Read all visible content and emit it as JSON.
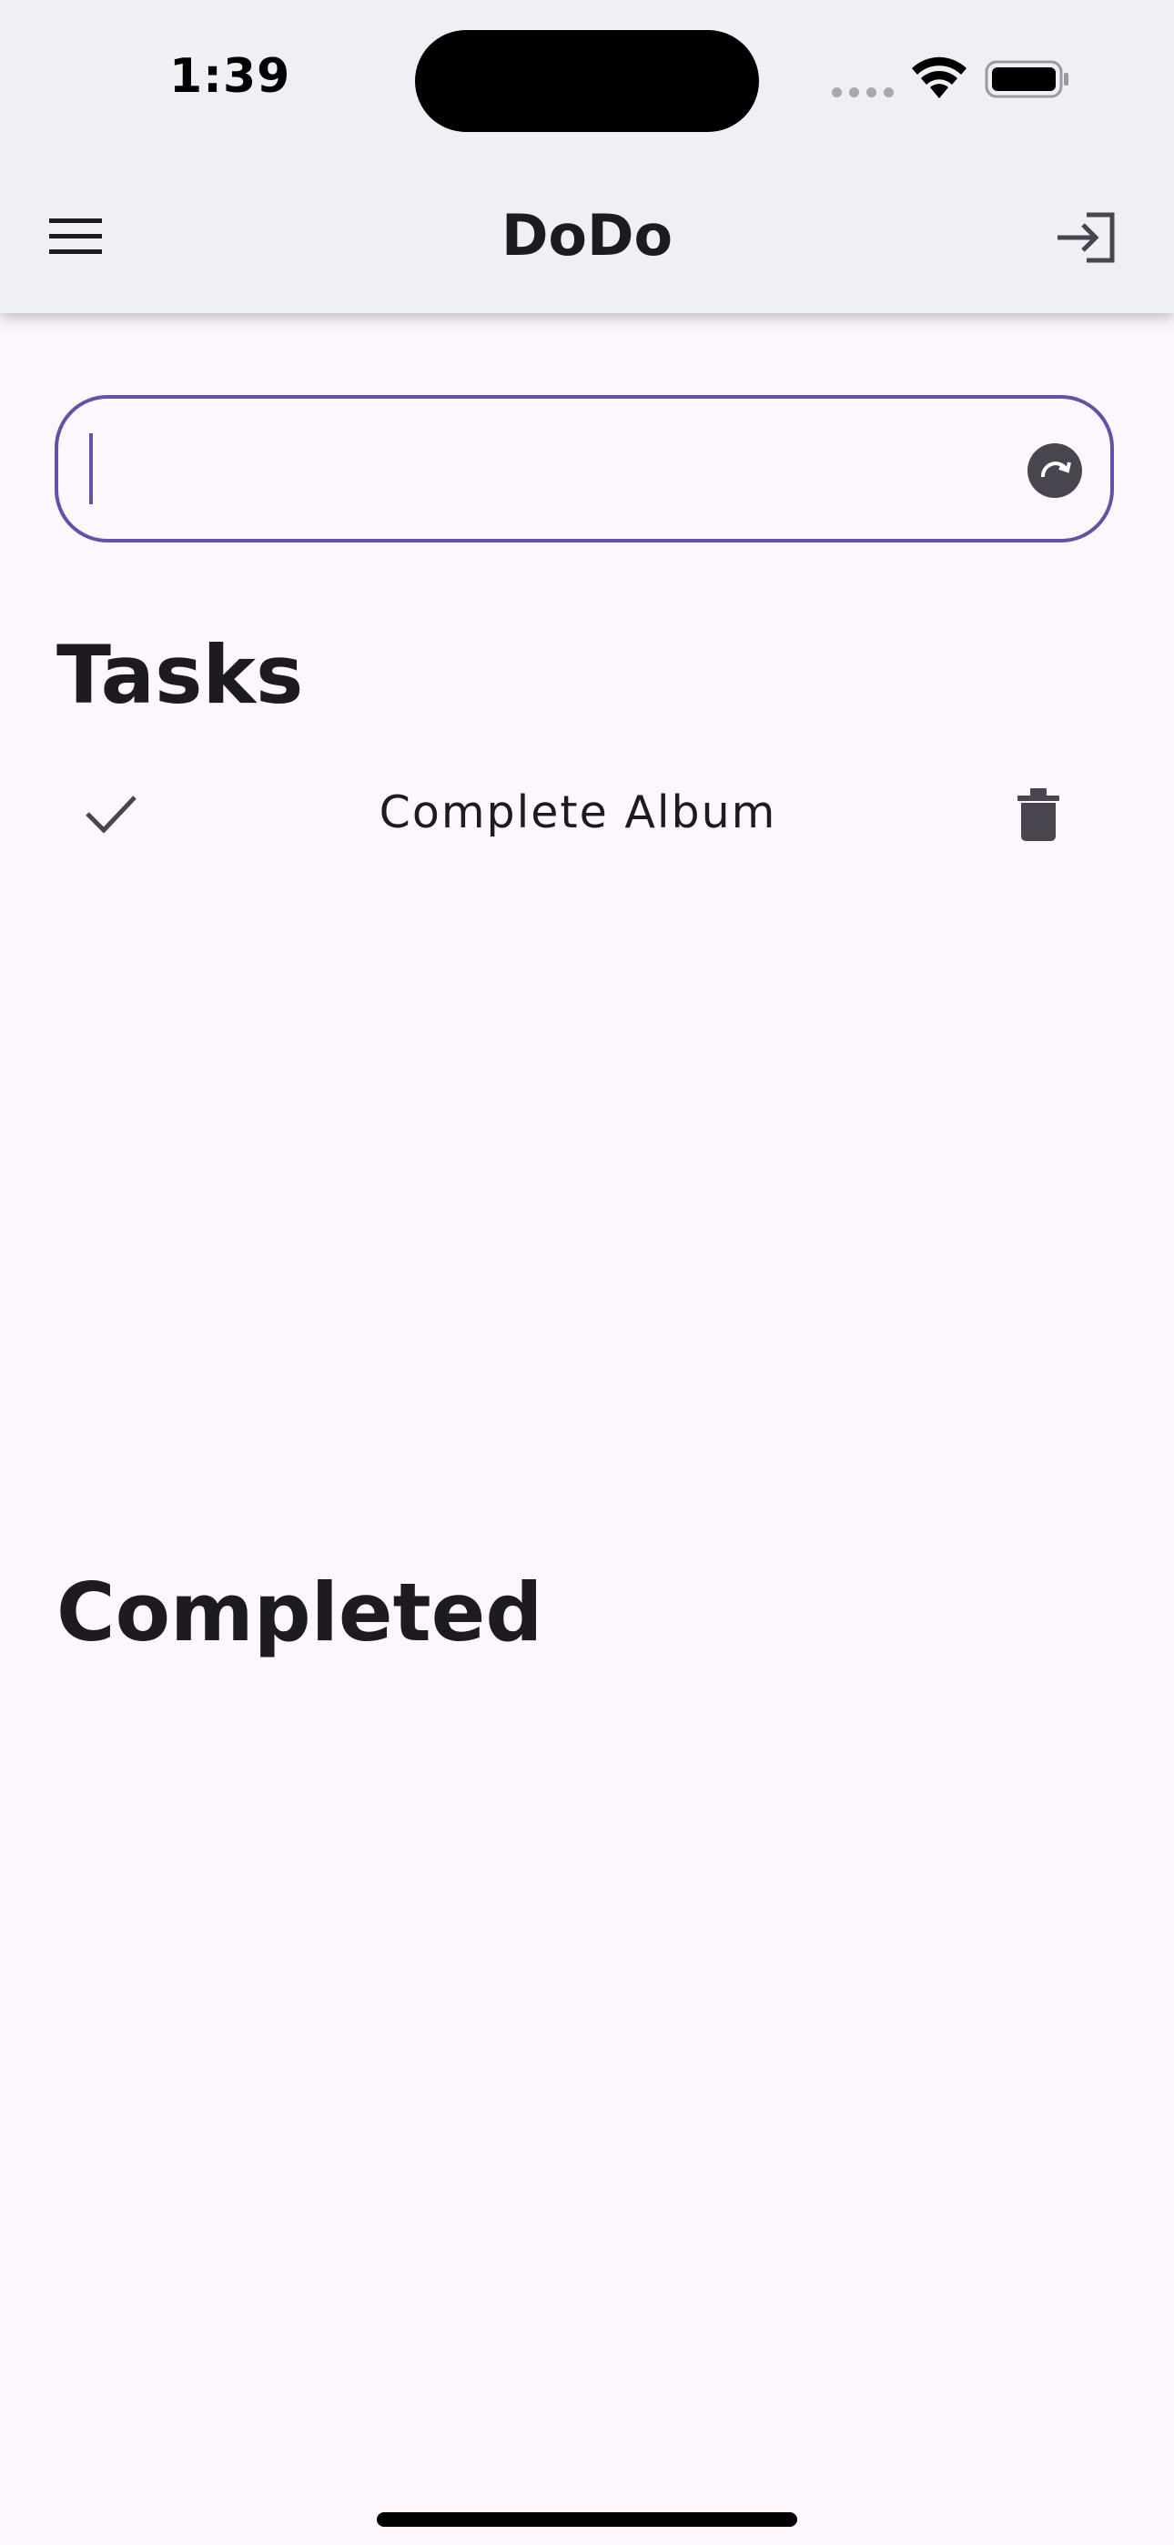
{
  "status_bar": {
    "time": "1:39"
  },
  "app_bar": {
    "title": "DoDo",
    "menu_icon": "hamburger-menu-icon",
    "login_icon": "login-icon"
  },
  "task_input": {
    "value": "",
    "placeholder": "",
    "submit_icon": "submit-arrow-icon"
  },
  "sections": {
    "tasks_title": "Tasks",
    "completed_title": "Completed"
  },
  "tasks": [
    {
      "label": "Complete Album",
      "check_icon": "checkmark-icon",
      "delete_icon": "trash-icon"
    }
  ],
  "colors": {
    "accent": "#6750a4",
    "app_bar_bg": "#efeff6",
    "page_bg": "#fdf7fd",
    "icon": "#49454f"
  }
}
